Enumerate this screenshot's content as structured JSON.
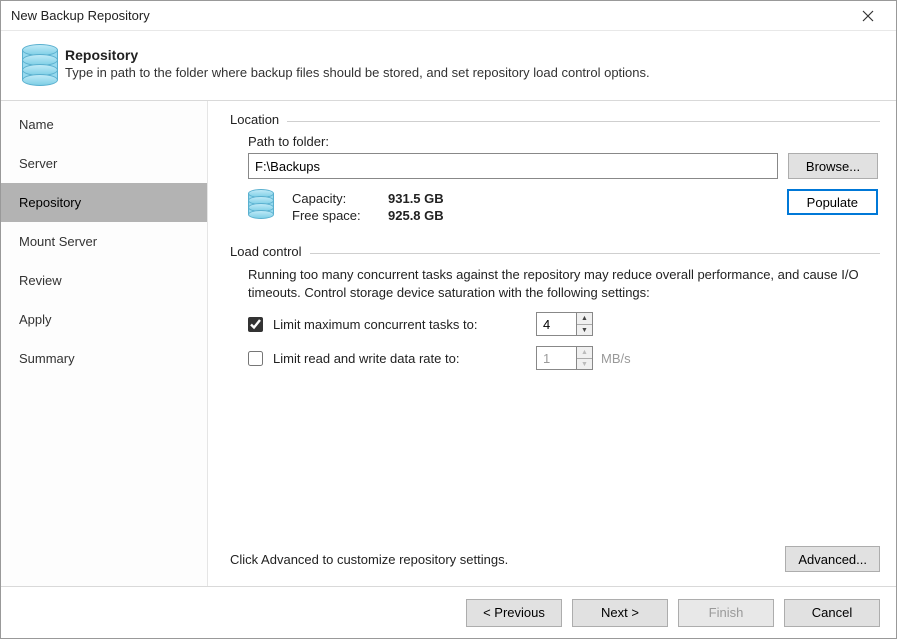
{
  "window": {
    "title": "New Backup Repository"
  },
  "header": {
    "title": "Repository",
    "subtitle": "Type in path to the folder where backup files should be stored, and set repository load control options."
  },
  "sidebar": {
    "items": [
      {
        "label": "Name"
      },
      {
        "label": "Server"
      },
      {
        "label": "Repository"
      },
      {
        "label": "Mount Server"
      },
      {
        "label": "Review"
      },
      {
        "label": "Apply"
      },
      {
        "label": "Summary"
      }
    ],
    "active_index": 2
  },
  "location_group": {
    "legend": "Location",
    "path_label": "Path to folder:",
    "path_value": "F:\\Backups",
    "browse_label": "Browse...",
    "populate_label": "Populate",
    "stats": {
      "capacity_label": "Capacity:",
      "capacity_value": "931.5 GB",
      "free_label": "Free space:",
      "free_value": "925.8 GB"
    }
  },
  "load_group": {
    "legend": "Load control",
    "description": "Running too many concurrent tasks against the repository may reduce overall performance, and cause I/O timeouts. Control storage device saturation with the following settings:",
    "opt_tasks": {
      "checked": true,
      "label": "Limit maximum concurrent tasks to:",
      "value": "4"
    },
    "opt_rate": {
      "checked": false,
      "label": "Limit read and write data rate to:",
      "value": "1",
      "unit": "MB/s"
    }
  },
  "advanced": {
    "hint": "Click Advanced to customize repository settings.",
    "button": "Advanced..."
  },
  "footer": {
    "previous": "< Previous",
    "next": "Next >",
    "finish": "Finish",
    "cancel": "Cancel"
  }
}
